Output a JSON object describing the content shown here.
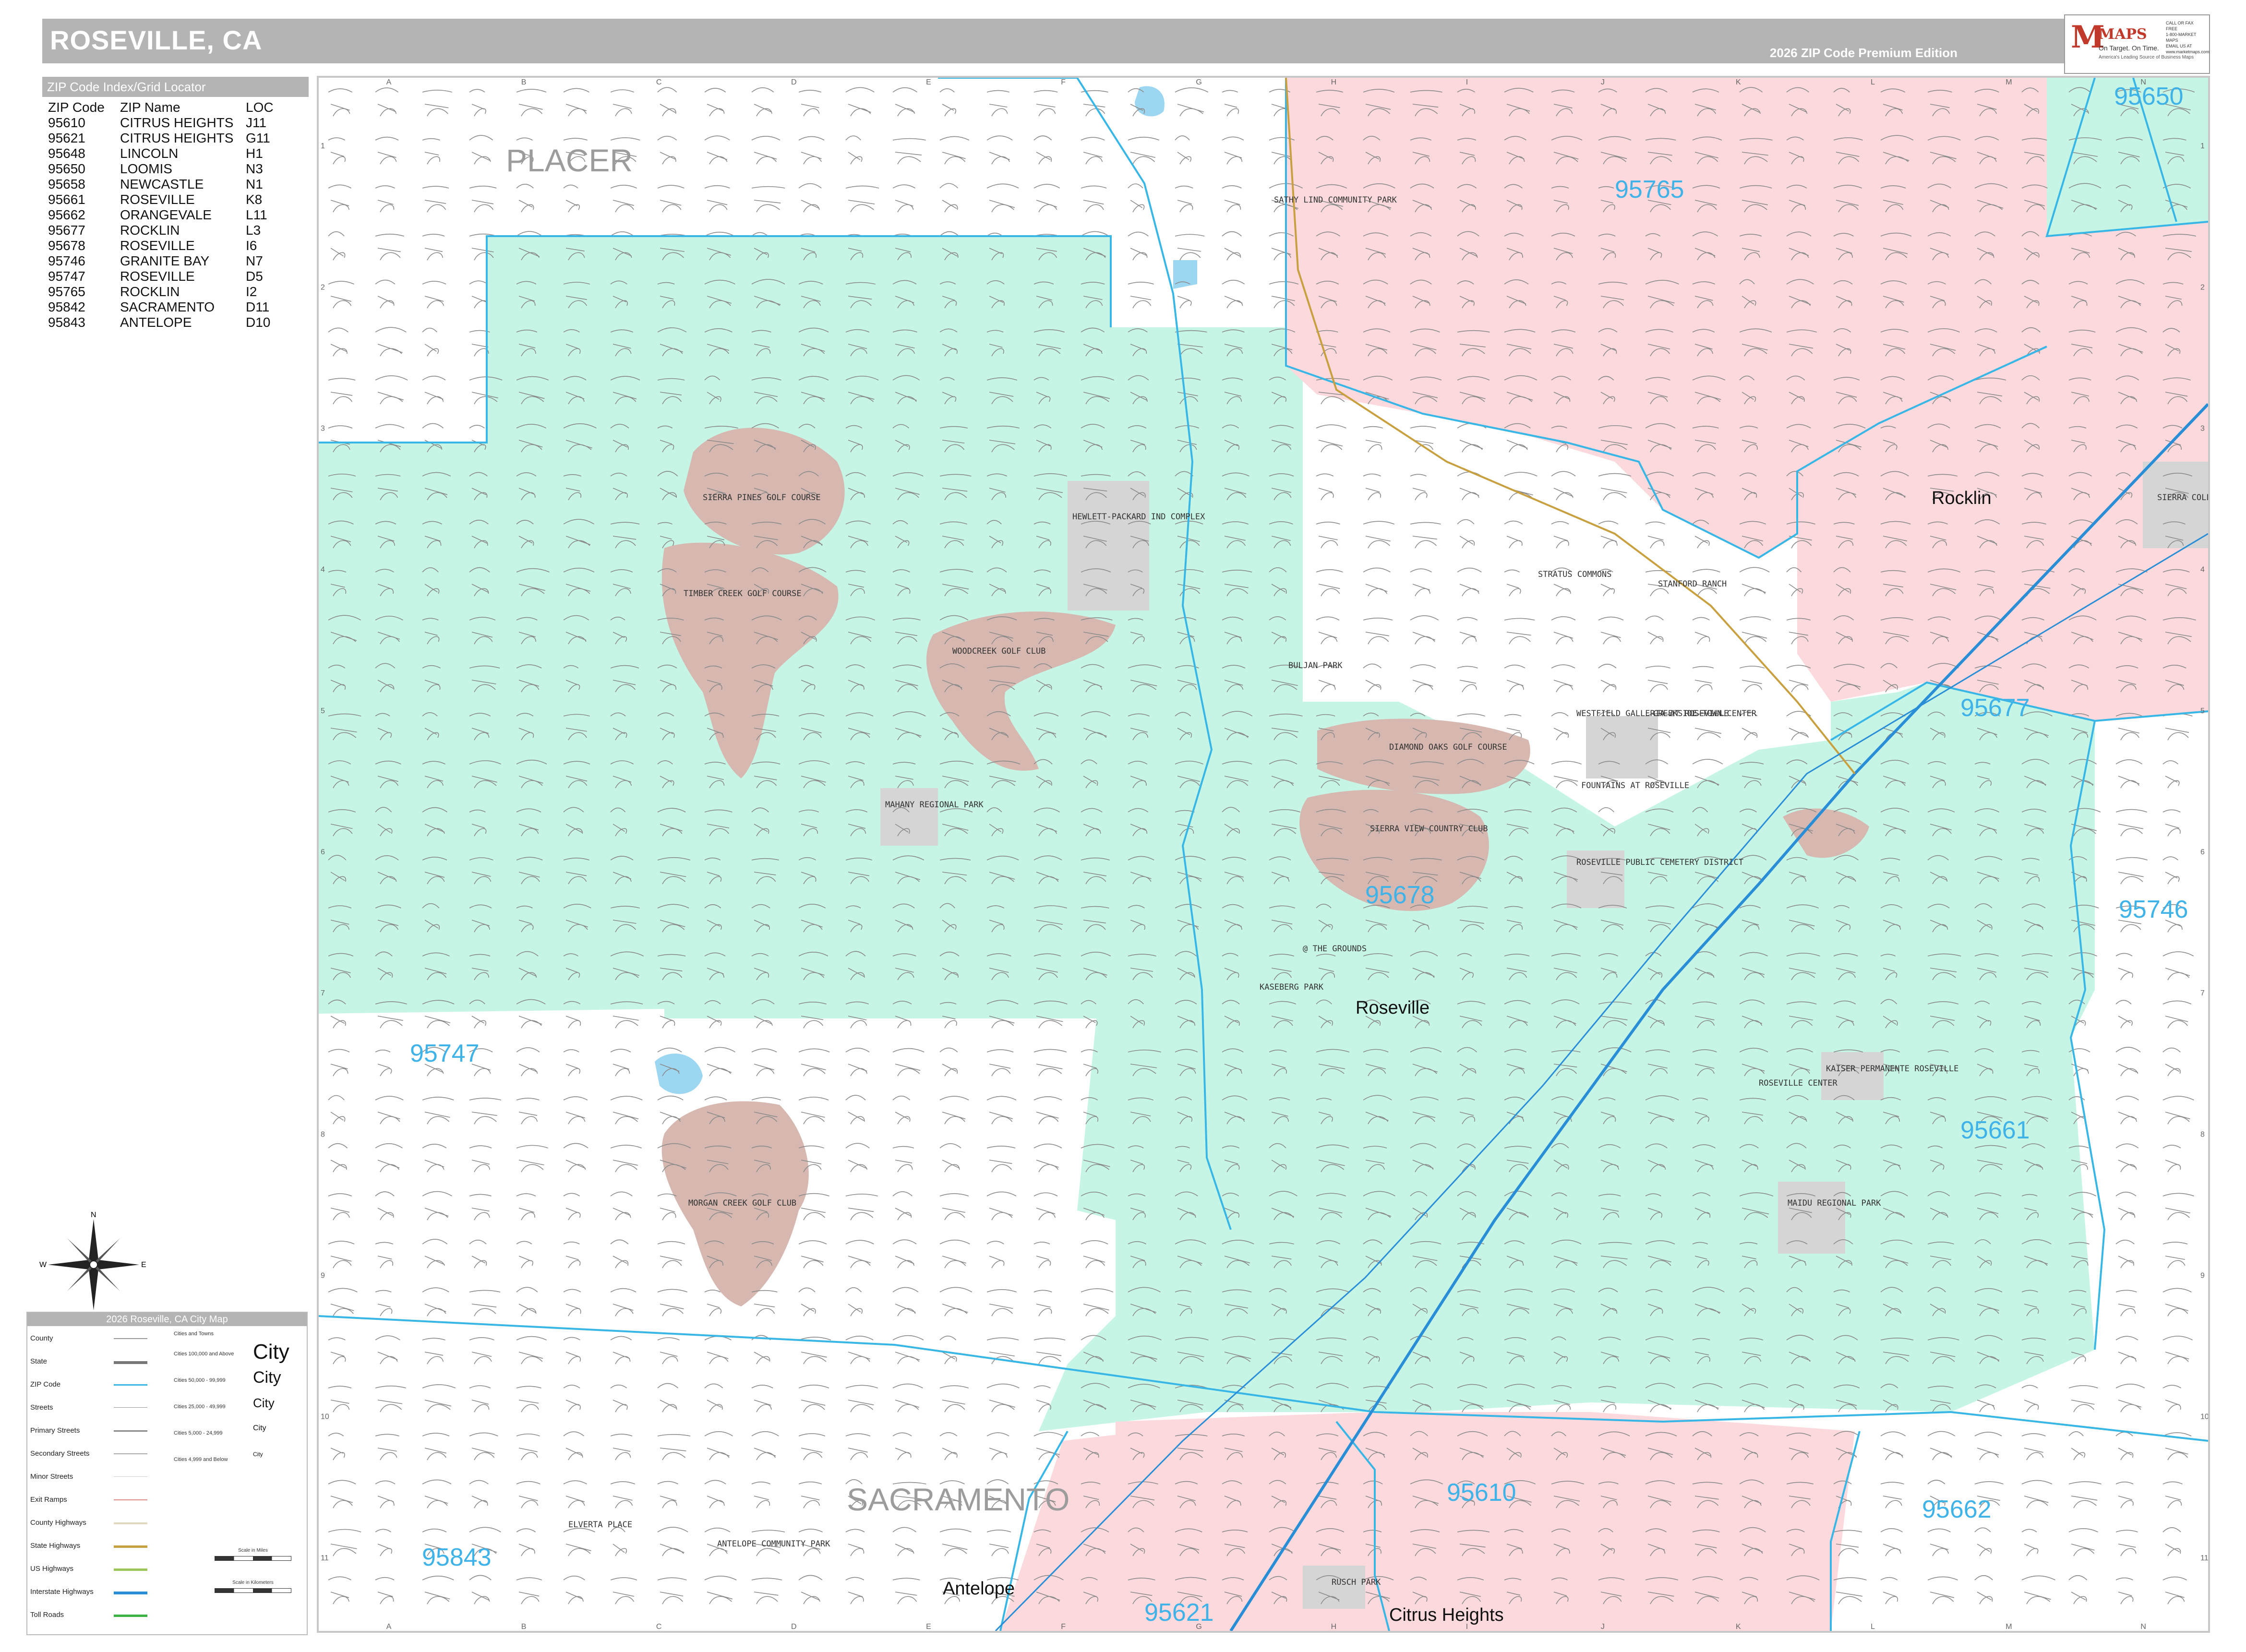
{
  "title": "ROSEVILLE, CA",
  "edition": "2026 ZIP Code Premium Edition",
  "logo": {
    "mark": "M",
    "name": "MAPS",
    "tagline": "On Target. On Time.",
    "subtag": "America's Leading Source of Business Maps",
    "contact": [
      "CALL OR FAX FREE",
      "1-800-MARKET MAPS",
      "EMAIL US AT",
      "www.marketmaps.com"
    ]
  },
  "zip_index": {
    "header": "ZIP Code Index/Grid Locator",
    "columns": [
      "ZIP Code",
      "ZIP Name",
      "LOC"
    ],
    "rows": [
      [
        "95610",
        "CITRUS HEIGHTS",
        "J11"
      ],
      [
        "95621",
        "CITRUS HEIGHTS",
        "G11"
      ],
      [
        "95648",
        "LINCOLN",
        "H1"
      ],
      [
        "95650",
        "LOOMIS",
        "N3"
      ],
      [
        "95658",
        "NEWCASTLE",
        "N1"
      ],
      [
        "95661",
        "ROSEVILLE",
        "K8"
      ],
      [
        "95662",
        "ORANGEVALE",
        "L11"
      ],
      [
        "95677",
        "ROCKLIN",
        "L3"
      ],
      [
        "95678",
        "ROSEVILLE",
        "I6"
      ],
      [
        "95746",
        "GRANITE BAY",
        "N7"
      ],
      [
        "95747",
        "ROSEVILLE",
        "D5"
      ],
      [
        "95765",
        "ROCKLIN",
        "I2"
      ],
      [
        "95842",
        "SACRAMENTO",
        "D11"
      ],
      [
        "95843",
        "ANTELOPE",
        "D10"
      ]
    ]
  },
  "grid": {
    "columns": [
      "A",
      "B",
      "C",
      "D",
      "E",
      "F",
      "G",
      "H",
      "I",
      "J",
      "K",
      "L",
      "M",
      "N"
    ],
    "rows": [
      "1",
      "2",
      "3",
      "4",
      "5",
      "6",
      "7",
      "8",
      "9",
      "10",
      "11"
    ]
  },
  "map": {
    "counties": [
      {
        "name": "PLACER"
      },
      {
        "name": "SACRAMENTO"
      }
    ],
    "zip_labels": [
      "95650",
      "95765",
      "95677",
      "95678",
      "95746",
      "95747",
      "95661",
      "95610",
      "95662",
      "95843",
      "95621"
    ],
    "cities": [
      "Rocklin",
      "Roseville",
      "Antelope",
      "Citrus Heights"
    ],
    "pois": [
      "SIERRA PINES GOLF COURSE",
      "TIMBER CREEK GOLF COURSE",
      "WOODCREEK GOLF CLUB",
      "HEWLETT-PACKARD IND COMPLEX",
      "MAHANY REGIONAL PARK",
      "BULJAN PARK",
      "DIAMOND OAKS GOLF COURSE",
      "SIERRA VIEW COUNTRY CLUB",
      "WESTFIELD GALLERIA AT ROSEVILLE",
      "CREEKSIDE TOWN CENTER",
      "STANFORD RANCH",
      "FOUNTAINS AT ROSEVILLE",
      "ROSEVILLE PUBLIC CEMETERY DISTRICT",
      "@ THE GROUNDS",
      "KASEBERG PARK",
      "ROSEVILLE CENTER",
      "KAISER PERMANENTE ROSEVILLE",
      "MAIDU REGIONAL PARK",
      "MORGAN CREEK GOLF CLUB",
      "SIERRA COLLEGE",
      "ELVERTA PLACE",
      "ANTELOPE COMMUNITY PARK",
      "RUSCH PARK",
      "SATHY LIND COMMUNITY PARK",
      "STRATUS COMMONS"
    ]
  },
  "legend": {
    "header": "2026 Roseville, CA City Map",
    "items": [
      "County",
      "State",
      "ZIP Code",
      "Streets",
      "Primary Streets",
      "Secondary Streets",
      "Minor Streets",
      "Exit Ramps",
      "County Highways",
      "State Highways",
      "US Highways",
      "Interstate Highways",
      "Toll Roads"
    ],
    "city_sizes_header": "Cities and Towns",
    "city_sizes": [
      {
        "range": "Cities 100,000 and Above",
        "sample": "City"
      },
      {
        "range": "Cities 50,000 - 99,999",
        "sample": "City"
      },
      {
        "range": "Cities 25,000 - 49,999",
        "sample": "City"
      },
      {
        "range": "Cities 5,000 - 24,999",
        "sample": "City"
      },
      {
        "range": "Cities 4,999 and Below",
        "sample": "City"
      }
    ],
    "scale_miles": "Scale in Miles",
    "scale_km": "Scale in Kilometers"
  },
  "colors": {
    "zip_green": "#c6f5e6",
    "zip_pink": "#fbd9dd",
    "golf_brown": "#d7b8b0",
    "zip_boundary": "#38b6e6",
    "title_bar": "#b4b4b4",
    "street": "#7a7a7a",
    "interstate": "#2a8ed6"
  },
  "compass": {
    "n": "N",
    "s": "S",
    "e": "E",
    "w": "W"
  }
}
